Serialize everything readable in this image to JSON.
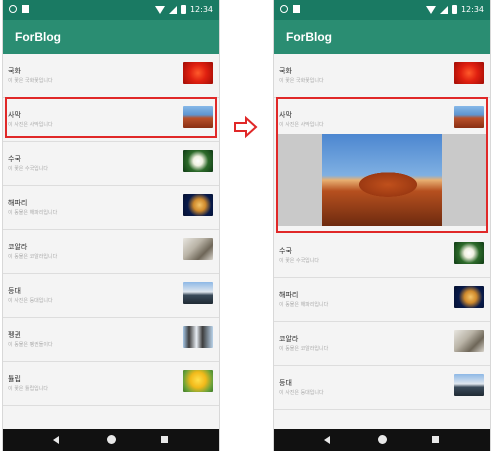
{
  "status": {
    "time": "12:34"
  },
  "app": {
    "title": "ForBlog"
  },
  "left_list": [
    {
      "title": "국화",
      "subtitle": "이 꽃은 국화꽃입니다",
      "thumb": "rose"
    },
    {
      "title": "사막",
      "subtitle": "이 사진은 사막입니다",
      "thumb": "desert"
    },
    {
      "title": "수국",
      "subtitle": "이 꽃은 수국입니다",
      "thumb": "flower"
    },
    {
      "title": "해파리",
      "subtitle": "이 동물은 해파리입니다",
      "thumb": "jelly"
    },
    {
      "title": "코알라",
      "subtitle": "이 동물은 코알라입니다",
      "thumb": "koala"
    },
    {
      "title": "등대",
      "subtitle": "이 사진은 등대입니다",
      "thumb": "lighthouse"
    },
    {
      "title": "펭귄",
      "subtitle": "이 동물은 펭귄들이다",
      "thumb": "penguins"
    },
    {
      "title": "튤립",
      "subtitle": "이 꽃은 튤립입니다",
      "thumb": "tulips"
    }
  ],
  "right_list": [
    {
      "title": "국화",
      "subtitle": "이 꽃은 국화꽃입니다",
      "thumb": "rose"
    },
    {
      "title": "사막",
      "subtitle": "이 사진은 사막입니다",
      "thumb": "desert"
    },
    {
      "title": "수국",
      "subtitle": "이 꽃은 수국입니다",
      "thumb": "flower"
    },
    {
      "title": "해파리",
      "subtitle": "이 동물은 해파리입니다",
      "thumb": "jelly"
    },
    {
      "title": "코알라",
      "subtitle": "이 동물은 코알라입니다",
      "thumb": "koala"
    },
    {
      "title": "등대",
      "subtitle": "이 사진은 등대입니다",
      "thumb": "lighthouse"
    }
  ],
  "colors": {
    "statusbar": "#1a7a63",
    "appbar": "#2a8d72",
    "highlight": "#e02828"
  },
  "icons": {
    "arrow": "right-arrow-icon",
    "back": "back-icon",
    "home": "home-icon",
    "recents": "recents-icon"
  }
}
